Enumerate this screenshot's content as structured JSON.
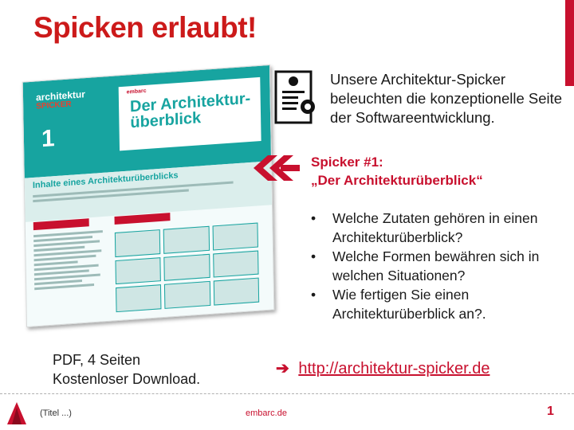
{
  "slide": {
    "title": "Spicken erlaubt!",
    "intro": "Unsere Architektur-Spicker beleuchten die konzeptionelle Seite der Softwareentwicklung.",
    "spicker_line1": "Spicker #1:",
    "spicker_line2": "„Der Architekturüberblick“",
    "bullets": [
      "Welche Zutaten gehören in einen Architekturüberblick?",
      "Welche Formen bewähren sich in welchen Situationen?",
      "Wie fertigen Sie einen Architekturüberblick an?."
    ],
    "pdf_line1": "PDF, 4 Seiten",
    "pdf_line2": "Kostenloser Download.",
    "link": "http://architektur-spicker.de"
  },
  "flyer": {
    "brand_top": "architektur",
    "brand_bottom": "SPICKER",
    "logo": "embarc",
    "heading": "Der Architektur-überblick",
    "number": "1",
    "section": "Inhalte eines Architekturüberblicks"
  },
  "footer": {
    "title": "(Titel ...)",
    "site": "embarc.de",
    "page": "1"
  },
  "colors": {
    "accent": "#c8102e",
    "teal": "#17a4a0"
  }
}
